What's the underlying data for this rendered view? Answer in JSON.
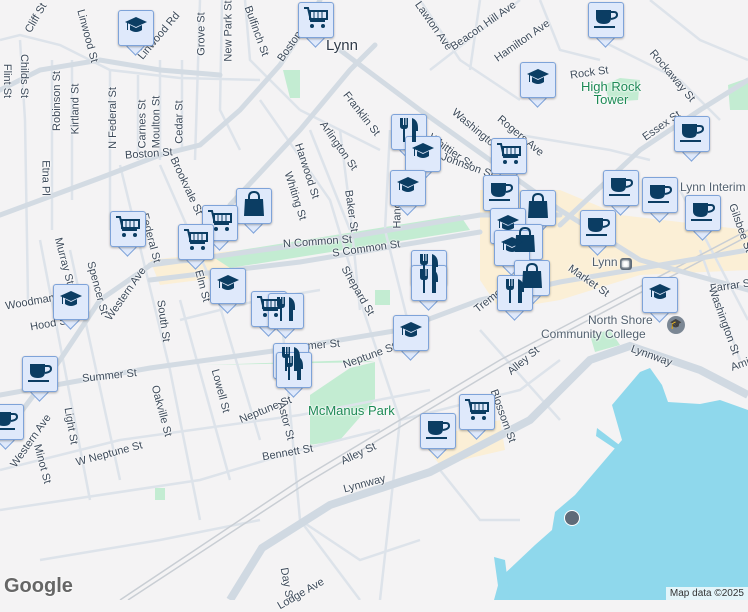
{
  "map": {
    "city": "Lynn",
    "streets": [
      "Lawton Ave",
      "Beacon Hill Ave",
      "Hamilton Ave",
      "Rock St",
      "Rockaway St",
      "Essex St",
      "Rogers Ave",
      "Washington St",
      "Whittier St",
      "Johnson St",
      "Franklin St",
      "Arlington St",
      "Harwood St",
      "Whiting St",
      "Baker St",
      "Hanover St",
      "N Common St",
      "S Common St",
      "Shepard St",
      "Market St",
      "Tremont St",
      "Farrar St",
      "Washington St",
      "Lynnway",
      "Lynnway",
      "Alley St",
      "Alley St",
      "Neptune St",
      "Neptune St",
      "Summer St",
      "Summer St",
      "Bennett St",
      "W Neptune St",
      "Oakville St",
      "Lowell St",
      "Astor St",
      "Light St",
      "Minot St",
      "Western Ave",
      "Western Ave",
      "South St",
      "Elm St",
      "Spencer St",
      "Murray St",
      "Woodman St",
      "Federal St",
      "Brookvale St",
      "Boston St",
      "Boston St",
      "N Federal St",
      "Carnes St",
      "Moulton St",
      "Cedar St",
      "Robinson St",
      "Kirtland St",
      "Etna Pl",
      "Childs St",
      "Linwood St",
      "Linwood Rd",
      "Grove St",
      "New Park St",
      "Bulfinch St",
      "Cliff St",
      "Flint St",
      "Day St",
      "Lodge Ave",
      "Blossom St",
      "Gilsbee St",
      "Amity St",
      "Hood St"
    ],
    "places": {
      "high_rock_tower": "High Rock Tower",
      "mcmanus_park": "McManus Park",
      "north_shore_cc_line1": "North Shore",
      "north_shore_cc_line2": "Community College",
      "lynn_station": "Lynn",
      "lynn_interim": "Lynn Interim"
    },
    "markers": [
      "school",
      "cart",
      "coffee",
      "school",
      "coffee",
      "restaurant",
      "school",
      "cart",
      "school",
      "coffee",
      "coffee",
      "coffee",
      "coffee",
      "bag",
      "cart",
      "cart",
      "cart",
      "bag",
      "school",
      "coffee",
      "bag",
      "school",
      "bag",
      "restaurant",
      "restaurant",
      "restaurant",
      "school",
      "school",
      "cart",
      "restaurant",
      "school",
      "restaurant",
      "restaurant",
      "coffee",
      "coffee",
      "coffee",
      "cart",
      "school"
    ],
    "colors": {
      "water": "#8fd8ec",
      "park": "#c3ecd2",
      "commercial": "#fbefd6",
      "marker_icon": "#0b3d63"
    }
  },
  "footer": {
    "logo": "Google",
    "attribution": "Map data ©2025"
  }
}
